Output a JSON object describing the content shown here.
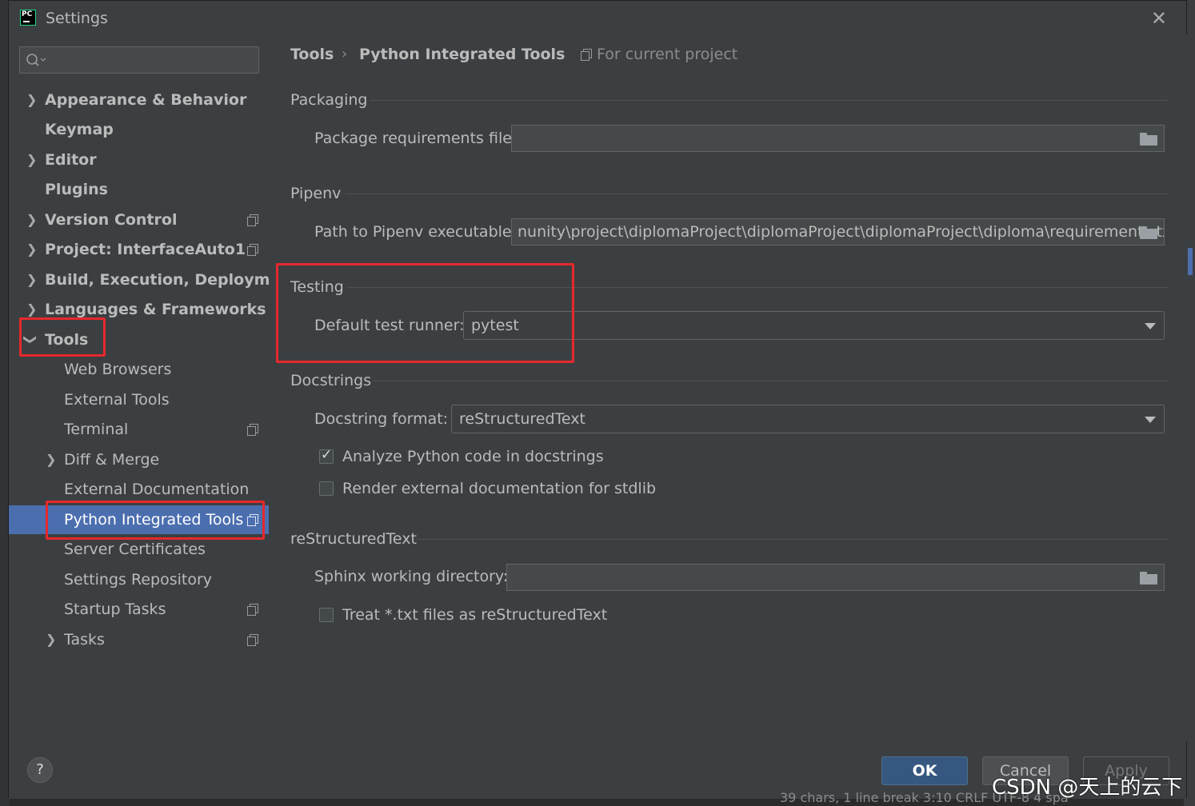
{
  "window": {
    "title": "Settings",
    "app_icon_text": "PC"
  },
  "sidebar": {
    "search": {
      "placeholder": "",
      "icon": "search-icon"
    },
    "items": [
      {
        "label": "Appearance & Behavior",
        "expandable": true
      },
      {
        "label": "Keymap",
        "expandable": false
      },
      {
        "label": "Editor",
        "expandable": true
      },
      {
        "label": "Plugins",
        "expandable": false
      },
      {
        "label": "Version Control",
        "expandable": true,
        "project_scoped": true
      },
      {
        "label": "Project: InterfaceAuto1",
        "expandable": true,
        "project_scoped": true
      },
      {
        "label": "Build, Execution, Deployment",
        "expandable": true
      },
      {
        "label": "Languages & Frameworks",
        "expandable": true
      },
      {
        "label": "Tools",
        "expanded": true
      }
    ],
    "tools_children": [
      {
        "label": "Web Browsers"
      },
      {
        "label": "External Tools"
      },
      {
        "label": "Terminal",
        "project_scoped": true
      },
      {
        "label": "Diff & Merge",
        "expandable": true
      },
      {
        "label": "External Documentation"
      },
      {
        "label": "Python Integrated Tools",
        "selected": true,
        "project_scoped": true
      },
      {
        "label": "Server Certificates"
      },
      {
        "label": "Settings Repository"
      },
      {
        "label": "Startup Tasks",
        "project_scoped": true
      },
      {
        "label": "Tasks",
        "expandable": true,
        "project_scoped": true
      }
    ]
  },
  "breadcrumb": {
    "parent": "Tools",
    "separator": "›",
    "current": "Python Integrated Tools",
    "scope": "For current project"
  },
  "packaging": {
    "title": "Packaging",
    "requirements_label": "Package requirements file:",
    "requirements_value": ""
  },
  "pipenv": {
    "title": "Pipenv",
    "path_label": "Path to Pipenv executable:",
    "path_value": "nunity\\project\\diplomaProject\\diplomaProject\\diplomaProject\\diploma\\requirements.txt"
  },
  "testing": {
    "title": "Testing",
    "runner_label": "Default test runner:",
    "runner_value": "pytest"
  },
  "docstrings": {
    "title": "Docstrings",
    "format_label": "Docstring format:",
    "format_value": "reStructuredText",
    "analyze_label": "Analyze Python code in docstrings",
    "analyze_checked": true,
    "render_label": "Render external documentation for stdlib",
    "render_checked": false
  },
  "rest": {
    "title": "reStructuredText",
    "sphinx_label": "Sphinx working directory:",
    "sphinx_value": "",
    "treat_label": "Treat *.txt files as reStructuredText",
    "treat_checked": false
  },
  "footer": {
    "help": "?",
    "ok": "OK",
    "cancel": "Cancel",
    "apply": "Apply"
  },
  "background_status": "39 chars, 1 line break    3:10    CRLF    UTF-8    4 spa",
  "watermark": "CSDN @天上的云下",
  "colors": {
    "accent": "#4b6eaf",
    "ok_button": "#365880",
    "annotation_red": "#e6282d"
  }
}
